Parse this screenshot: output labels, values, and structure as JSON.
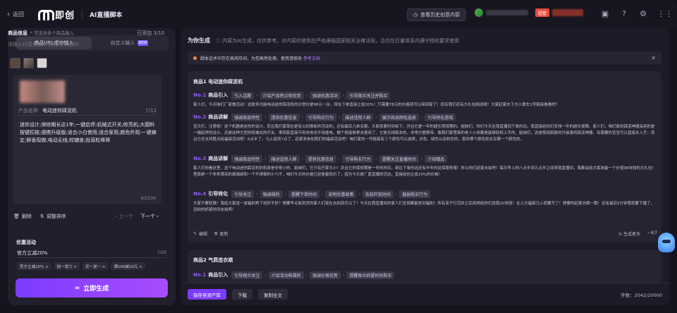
{
  "topbar": {
    "back": "返回",
    "logo": "即创",
    "page": "AI直播脚本",
    "history": "查看历史创意内容",
    "badge": "超管"
  },
  "left": {
    "tabs": [
      {
        "label": "商品URL或ID输入"
      },
      {
        "label": "自定义输入",
        "badge": "NEW"
      }
    ],
    "info_label": "商品信息",
    "info_hint": "* 可支持多个商品输入",
    "info_count": "已添加 3/10",
    "url_placeholder": "请输入抖音商品url链接或商品ID",
    "product_name_key": "产品名称",
    "product_name": "电动迷你踩泥机",
    "name_count": "7/12",
    "selling_points": "迷你设计;保修期长达1年;一键启停;机械式开关;皎亮机;大圆料按键扣按;便携升级版;适合小白使用;适合家用;颜色外观:一键搞定;鲜香现做;电动无线;校辅食;投蒜粒棒棒",
    "selling_count": "83/200",
    "delete": "删除",
    "sort": "调整排序",
    "prev": "上一个",
    "next": "下一个",
    "discount_title": "优惠活动",
    "discount_value": "官方立减20%",
    "discount_count": "7/20",
    "chips": [
      "官方立减20% +",
      "拍一发六 +",
      "买一送一 +",
      "满100减10元 +"
    ],
    "generate": "立即生成"
  },
  "right": {
    "title": "为你生成",
    "desc": "内容为AI生成，仅供参考。对内容的使用应严格遵循国家相关法律法规，且仅在巨量体系内遵守授权要求使用",
    "notice": "脚本话术中存在高风险词，为您高亮处理，使用请修改",
    "notice_link": "参考文档",
    "card1": {
      "title": "商品1 电动迷你踩泥机",
      "sections": [
        {
          "no": "No.1",
          "name": "商品引入",
          "tags": [
            "引入话题",
            "介绍产品特点和优势",
            "强调优惠活动",
            "引导观众关注并购买"
          ],
          "body": "家人们，今天咱们厂家做活动！这款多功能电动迷你踩泥机的日常价是98元一台，现在下单直接立省20%！只需要78元的价格就可以带回家了！抓后我们还有大礼包相送哦！大家赶紧去下方小黄车1号链接看看吧！"
        },
        {
          "no": "No.2",
          "name": "商品讲解",
          "tags": [
            "强调商品特性",
            "提供优惠信息",
            "引导购买行为",
            "描述适用人群",
            "展示商品颜色选择",
            "引导转化游戏"
          ],
          "body": "宝贝们，注意啦！这个机器是迷你的设计，而且我们家现在是有以旧换新的活动的，还有最后几单名额，大家抓紧时间拍下，并且它是一年的超长质保期的。姐妹们，你们今天在我直播间下单的话，我直接给你们安排一年的超长保障。家人们，咱们家的踩泥神器采用的是一键起停的设计，还是这种大型的机械式的开关，拿回家直接不用充电也不用插电，做个既能够拿去使用了。它是无线版本的，非常方便携带。像我们家里面的老人小孩都是能够轻松上手的，姐妹们，这是我现新款的升级版的踩泥神器，有需要的宝宝可以直接去入手，而且它还支持整点给福袋活动呢！6点半了，马上就到7点了，赶紧来参加我们的福袋活动吧！咱们家的一号链接有三个颜色可以选择，白色、绿色以及粉色的，喜欢哪个颜色就去买哪一个颜色的。"
        },
        {
          "no": "No.3",
          "name": "商品讲解",
          "tags": [
            "强调商品特性",
            "描述适用人群",
            "提供优惠信息",
            "引导购买行为",
            "提醒关注直播时间",
            "介绍赠品"
          ],
          "body": "家人们你看这里，这个电动迷你踩泥机的机身是非常小的，姐妹们，它只有巴掌大小！并且它的保修期是一年的时间，现在下单的话还有半年的延保服务哦！所以你们赶紧去拍吧！每天早上的八点半到九点半之间来我直播间，我都会给大家准备一个价值98块钱的大礼包！里面是一个非常漂亮的玻璃碗和一个不锈钢的小勺子，咱们今天的价格已经是最低价了，因为今天是厂家直播的活动，直接给你立省20%的价格！"
        },
        {
          "no": "No.4",
          "name": "引导转化",
          "tags": [
            "引导关注",
            "强调福利",
            "提醒下单时间",
            "说明优惠政策",
            "告知开奖时间",
            "鼓励购买行为"
          ],
          "body": "大家不要犹豫！我给大家送一波福利再下班好不好？想要早点收到货的家人们现在去拍就可以了！今天在我直播间的家人们全部都能抢到福利！所有亲子打完折之后就再给你们送我20块钱！在上方福袋马上就要开了！想要的赶紧去戳一戳！还有最后5分钟我就要下播了，没拍的抓紧时间去拍啊！"
        }
      ],
      "edit": "编辑",
      "copy": "复制",
      "more": "生成更多",
      "pager": "4/7"
    },
    "card2": {
      "title": "商品2 气质连衣裙",
      "section": {
        "no": "No.1",
        "name": "商品引入",
        "tags": [
          "引导观众关注",
          "介绍活动和福利",
          "强调价格优势",
          "提醒观众抓紧时间购买"
        ]
      }
    },
    "bottom": {
      "save": "保存至资产库",
      "download": "下载",
      "copy_all": "复制全文",
      "word_count": "字数：2042/20000"
    }
  }
}
